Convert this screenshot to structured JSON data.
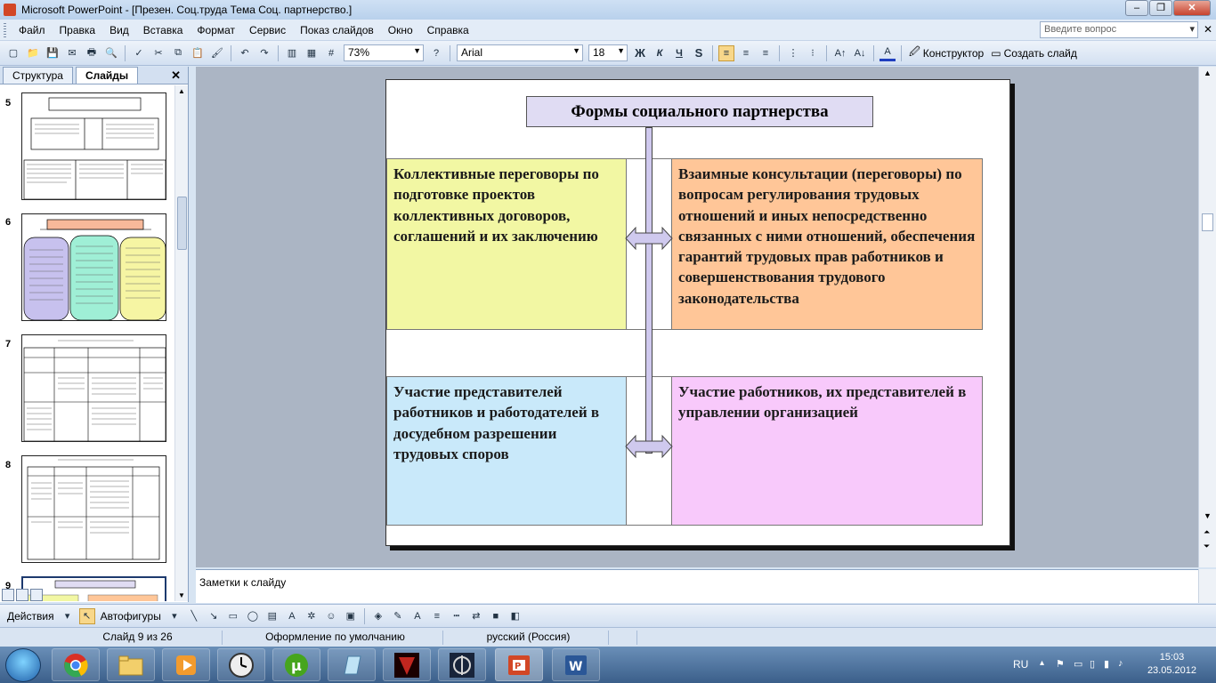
{
  "window": {
    "title": "Microsoft PowerPoint - [Презен. Соц.труда Тема Соц. партнерство.]"
  },
  "menu": {
    "items": [
      "Файл",
      "Правка",
      "Вид",
      "Вставка",
      "Формат",
      "Сервис",
      "Показ слайдов",
      "Окно",
      "Справка"
    ],
    "help_placeholder": "Введите вопрос"
  },
  "toolbar": {
    "zoom": "73%",
    "font_name": "Arial",
    "font_size": "18",
    "bold": "Ж",
    "italic": "К",
    "underline": "Ч",
    "shadow": "S",
    "designer": "Конструктор",
    "new_slide": "Создать слайд"
  },
  "left_pane": {
    "tabs": [
      "Структура",
      "Слайды"
    ],
    "active_tab": "Слайды",
    "thumbnails": [
      {
        "number": "5"
      },
      {
        "number": "6"
      },
      {
        "number": "7"
      },
      {
        "number": "8"
      },
      {
        "number": "9"
      }
    ]
  },
  "slide": {
    "title": "Формы социального партнерства",
    "boxes": [
      {
        "text": "Коллективные переговоры по подготовке проектов коллективных договоров, соглашений и их заключению",
        "color": "#f2f7a3"
      },
      {
        "text": "Взаимные консультации (переговоры) по вопросам регулирования трудовых отношений и иных непосредственно связанных с ними отношений, обеспечения гарантий трудовых прав работников и совершенствования трудового законодательства",
        "color": "#ffc698"
      },
      {
        "text": "Участие представителей работников и работодателей в досудебном разрешении трудовых споров",
        "color": "#c9e9fa"
      },
      {
        "text": "Участие работников, их представителей в управлении организацией",
        "color": "#f8c9fb"
      }
    ]
  },
  "notes": {
    "placeholder": "Заметки к слайду"
  },
  "drawing_toolbar": {
    "actions": "Действия",
    "autoshapes": "Автофигуры"
  },
  "status": {
    "slide_info": "Слайд 9 из 26",
    "design": "Оформление по умолчанию",
    "language": "русский (Россия)"
  },
  "taskbar": {
    "lang": "RU",
    "time": "15:03",
    "date": "23.05.2012"
  }
}
